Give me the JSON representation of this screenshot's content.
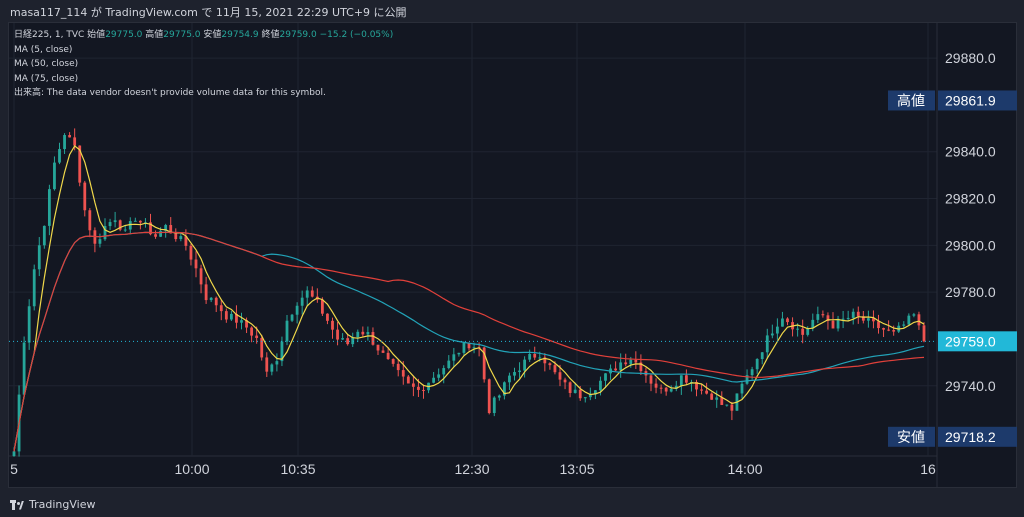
{
  "header": {
    "text": "masa117_114 が TradingView.com で 11月 15, 2021 22:29 UTC+9 に公開"
  },
  "legend": {
    "symbol": "日経225, 1, TVC",
    "open_label": "始値",
    "open": "29775.0",
    "high_label": "高値",
    "high": "29775.0",
    "low_label": "安値",
    "low": "29754.9",
    "close_label": "終値",
    "close": "29759.0",
    "change": "−15.2 (−0.05%)",
    "ma1": "MA (5, close)",
    "ma2": "MA (50, close)",
    "ma3": "MA (75, close)",
    "volume_prefix": "出来高:",
    "volume_note": "The data vendor doesn't provide volume data for this symbol."
  },
  "price_axis": {
    "ticks": [
      "29880.0",
      "29840.0",
      "29820.0",
      "29800.0",
      "29780.0",
      "29740.0"
    ],
    "high_badge_label": "高値",
    "high_badge_value": "29861.9",
    "low_badge_label": "安値",
    "low_badge_value": "29718.2",
    "current_value": "29759.0"
  },
  "time_axis": {
    "ticks": [
      "5",
      "10:00",
      "10:35",
      "12:30",
      "13:05",
      "14:00",
      "16"
    ]
  },
  "footer": {
    "brand": "TradingView"
  },
  "colors": {
    "up": "#26a69a",
    "down": "#ef5350",
    "ma5": "#f0d84a",
    "ma50": "#22a3b8",
    "ma75": "#e0403a",
    "current": "#22b8d8",
    "badge": "#1d3a6b"
  },
  "chart_data": {
    "type": "candlestick",
    "title": "日経225, 1, TVC",
    "ylim": [
      29710,
      29895
    ],
    "x_ticks": [
      "5",
      "10:00",
      "10:35",
      "12:30",
      "13:05",
      "14:00",
      "16"
    ],
    "y_ticks": [
      29880,
      29840,
      29820,
      29800,
      29780,
      29740
    ],
    "last": {
      "open": 29775.0,
      "high": 29775.0,
      "low": 29754.9,
      "close": 29759.0,
      "change": -15.2,
      "change_pct": -0.05
    },
    "session_high": 29861.9,
    "session_low": 29718.2,
    "close_path": [
      [
        0,
        29712
      ],
      [
        2,
        29760
      ],
      [
        4,
        29790
      ],
      [
        6,
        29810
      ],
      [
        8,
        29835
      ],
      [
        10,
        29848
      ],
      [
        12,
        29842
      ],
      [
        14,
        29815
      ],
      [
        16,
        29800
      ],
      [
        18,
        29808
      ],
      [
        20,
        29812
      ],
      [
        22,
        29805
      ],
      [
        24,
        29812
      ],
      [
        26,
        29808
      ],
      [
        28,
        29804
      ],
      [
        30,
        29808
      ],
      [
        32,
        29804
      ],
      [
        34,
        29800
      ],
      [
        36,
        29790
      ],
      [
        38,
        29778
      ],
      [
        40,
        29775
      ],
      [
        42,
        29770
      ],
      [
        44,
        29768
      ],
      [
        46,
        29765
      ],
      [
        48,
        29760
      ],
      [
        50,
        29745
      ],
      [
        52,
        29752
      ],
      [
        54,
        29768
      ],
      [
        56,
        29776
      ],
      [
        58,
        29780
      ],
      [
        60,
        29775
      ],
      [
        62,
        29768
      ],
      [
        64,
        29760
      ],
      [
        66,
        29758
      ],
      [
        68,
        29764
      ],
      [
        70,
        29762
      ],
      [
        72,
        29756
      ],
      [
        74,
        29750
      ],
      [
        76,
        29745
      ],
      [
        78,
        29740
      ],
      [
        80,
        29738
      ],
      [
        82,
        29742
      ],
      [
        84,
        29746
      ],
      [
        86,
        29750
      ],
      [
        88,
        29755
      ],
      [
        90,
        29758
      ],
      [
        92,
        29756
      ],
      [
        94,
        29730
      ],
      [
        96,
        29736
      ],
      [
        98,
        29744
      ],
      [
        100,
        29748
      ],
      [
        102,
        29752
      ],
      [
        104,
        29754
      ],
      [
        106,
        29748
      ],
      [
        108,
        29742
      ],
      [
        110,
        29738
      ],
      [
        112,
        29736
      ],
      [
        114,
        29738
      ],
      [
        116,
        29742
      ],
      [
        118,
        29746
      ],
      [
        120,
        29750
      ],
      [
        122,
        29752
      ],
      [
        124,
        29748
      ],
      [
        126,
        29742
      ],
      [
        128,
        29738
      ],
      [
        130,
        29740
      ],
      [
        132,
        29744
      ],
      [
        134,
        29742
      ],
      [
        136,
        29738
      ],
      [
        138,
        29736
      ],
      [
        140,
        29732
      ],
      [
        142,
        29730
      ],
      [
        144,
        29740
      ],
      [
        146,
        29748
      ],
      [
        148,
        29756
      ],
      [
        150,
        29764
      ],
      [
        152,
        29770
      ],
      [
        154,
        29766
      ],
      [
        156,
        29762
      ],
      [
        158,
        29768
      ],
      [
        160,
        29770
      ],
      [
        162,
        29766
      ],
      [
        164,
        29768
      ],
      [
        166,
        29770
      ],
      [
        168,
        29768
      ],
      [
        170,
        29766
      ],
      [
        172,
        29764
      ],
      [
        174,
        29762
      ],
      [
        176,
        29766
      ],
      [
        178,
        29770
      ],
      [
        180,
        29759
      ]
    ],
    "series": [
      {
        "name": "MA (5, close)"
      },
      {
        "name": "MA (50, close)"
      },
      {
        "name": "MA (75, close)"
      }
    ]
  }
}
